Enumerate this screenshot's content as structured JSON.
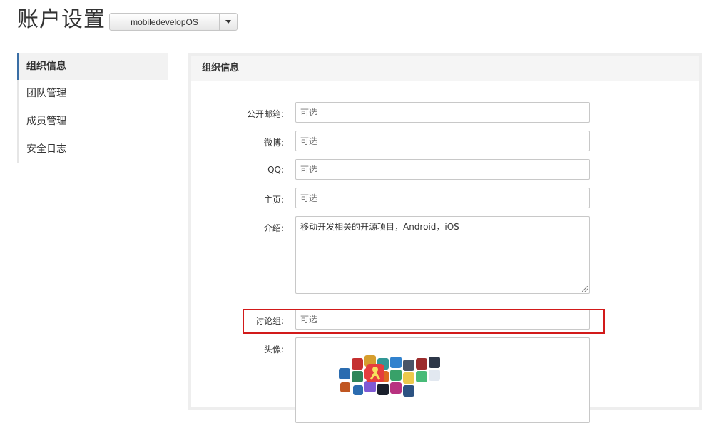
{
  "header": {
    "title": "账户设置",
    "org_select": {
      "value": "mobiledevelopOS"
    }
  },
  "sidebar": {
    "items": [
      {
        "label": "组织信息",
        "active": true
      },
      {
        "label": "团队管理"
      },
      {
        "label": "成员管理"
      },
      {
        "label": "安全日志"
      }
    ]
  },
  "panel": {
    "title": "组织信息",
    "fields": {
      "email": {
        "label": "公开邮箱:",
        "value": "",
        "placeholder": "可选"
      },
      "weibo": {
        "label": "微博:",
        "value": "",
        "placeholder": "可选"
      },
      "qq": {
        "label": "QQ:",
        "value": "",
        "placeholder": "可选"
      },
      "homepage": {
        "label": "主页:",
        "value": "",
        "placeholder": "可选"
      },
      "intro": {
        "label": "介绍:",
        "value": "移动开发相关的开源项目，Android，iOS"
      },
      "group": {
        "label": "讨论组:",
        "value": "",
        "placeholder": "可选",
        "highlighted": true
      },
      "avatar": {
        "label": "头像:"
      }
    }
  },
  "colors": {
    "highlight": "#d21a1a",
    "active_accent": "#3a6ea5"
  }
}
